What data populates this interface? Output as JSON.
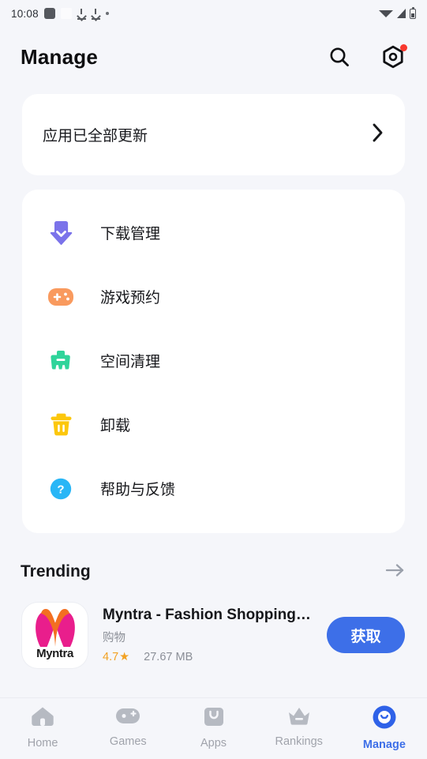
{
  "status_bar": {
    "time": "10:08",
    "left_icons": [
      "dark-square-icon",
      "light-square-icon",
      "download-icon",
      "download-icon",
      "dot-icon"
    ],
    "right_icons": [
      "wifi-icon",
      "signal-icon",
      "battery-icon"
    ]
  },
  "header": {
    "title": "Manage",
    "search_icon": "search-icon",
    "settings_icon": "settings-gear-icon",
    "settings_has_badge": true
  },
  "update_card": {
    "text": "应用已全部更新",
    "chevron": "chevron-right-icon"
  },
  "menu": {
    "items": [
      {
        "label": "下载管理",
        "icon": "download-manager-icon",
        "color": "#7b73ea"
      },
      {
        "label": "游戏预约",
        "icon": "game-controller-icon",
        "color": "#f99a5e"
      },
      {
        "label": "空间清理",
        "icon": "space-clean-icon",
        "color": "#2fd49a"
      },
      {
        "label": "卸载",
        "icon": "trash-icon",
        "color": "#fcc70d"
      },
      {
        "label": "帮助与反馈",
        "icon": "help-circle-icon",
        "color": "#29b6f6"
      }
    ]
  },
  "trending": {
    "title": "Trending",
    "more_icon": "arrow-right-icon",
    "app": {
      "icon_text": "Myntra",
      "name": "Myntra - Fashion Shopping…",
      "category": "购物",
      "rating": "4.7",
      "star": "★",
      "size": "27.67 MB",
      "action_label": "获取"
    }
  },
  "bottom_nav": {
    "items": [
      {
        "label": "Home",
        "icon": "home-icon",
        "active": false
      },
      {
        "label": "Games",
        "icon": "games-controller-icon",
        "active": false
      },
      {
        "label": "Apps",
        "icon": "apps-bag-icon",
        "active": false
      },
      {
        "label": "Rankings",
        "icon": "crown-icon",
        "active": false
      },
      {
        "label": "Manage",
        "icon": "manage-smile-icon",
        "active": true
      }
    ]
  },
  "colors": {
    "accent": "#3d6fe8",
    "background": "#f5f6fa",
    "card": "#ffffff",
    "badge": "#f8382e",
    "muted": "#8b8f97"
  }
}
